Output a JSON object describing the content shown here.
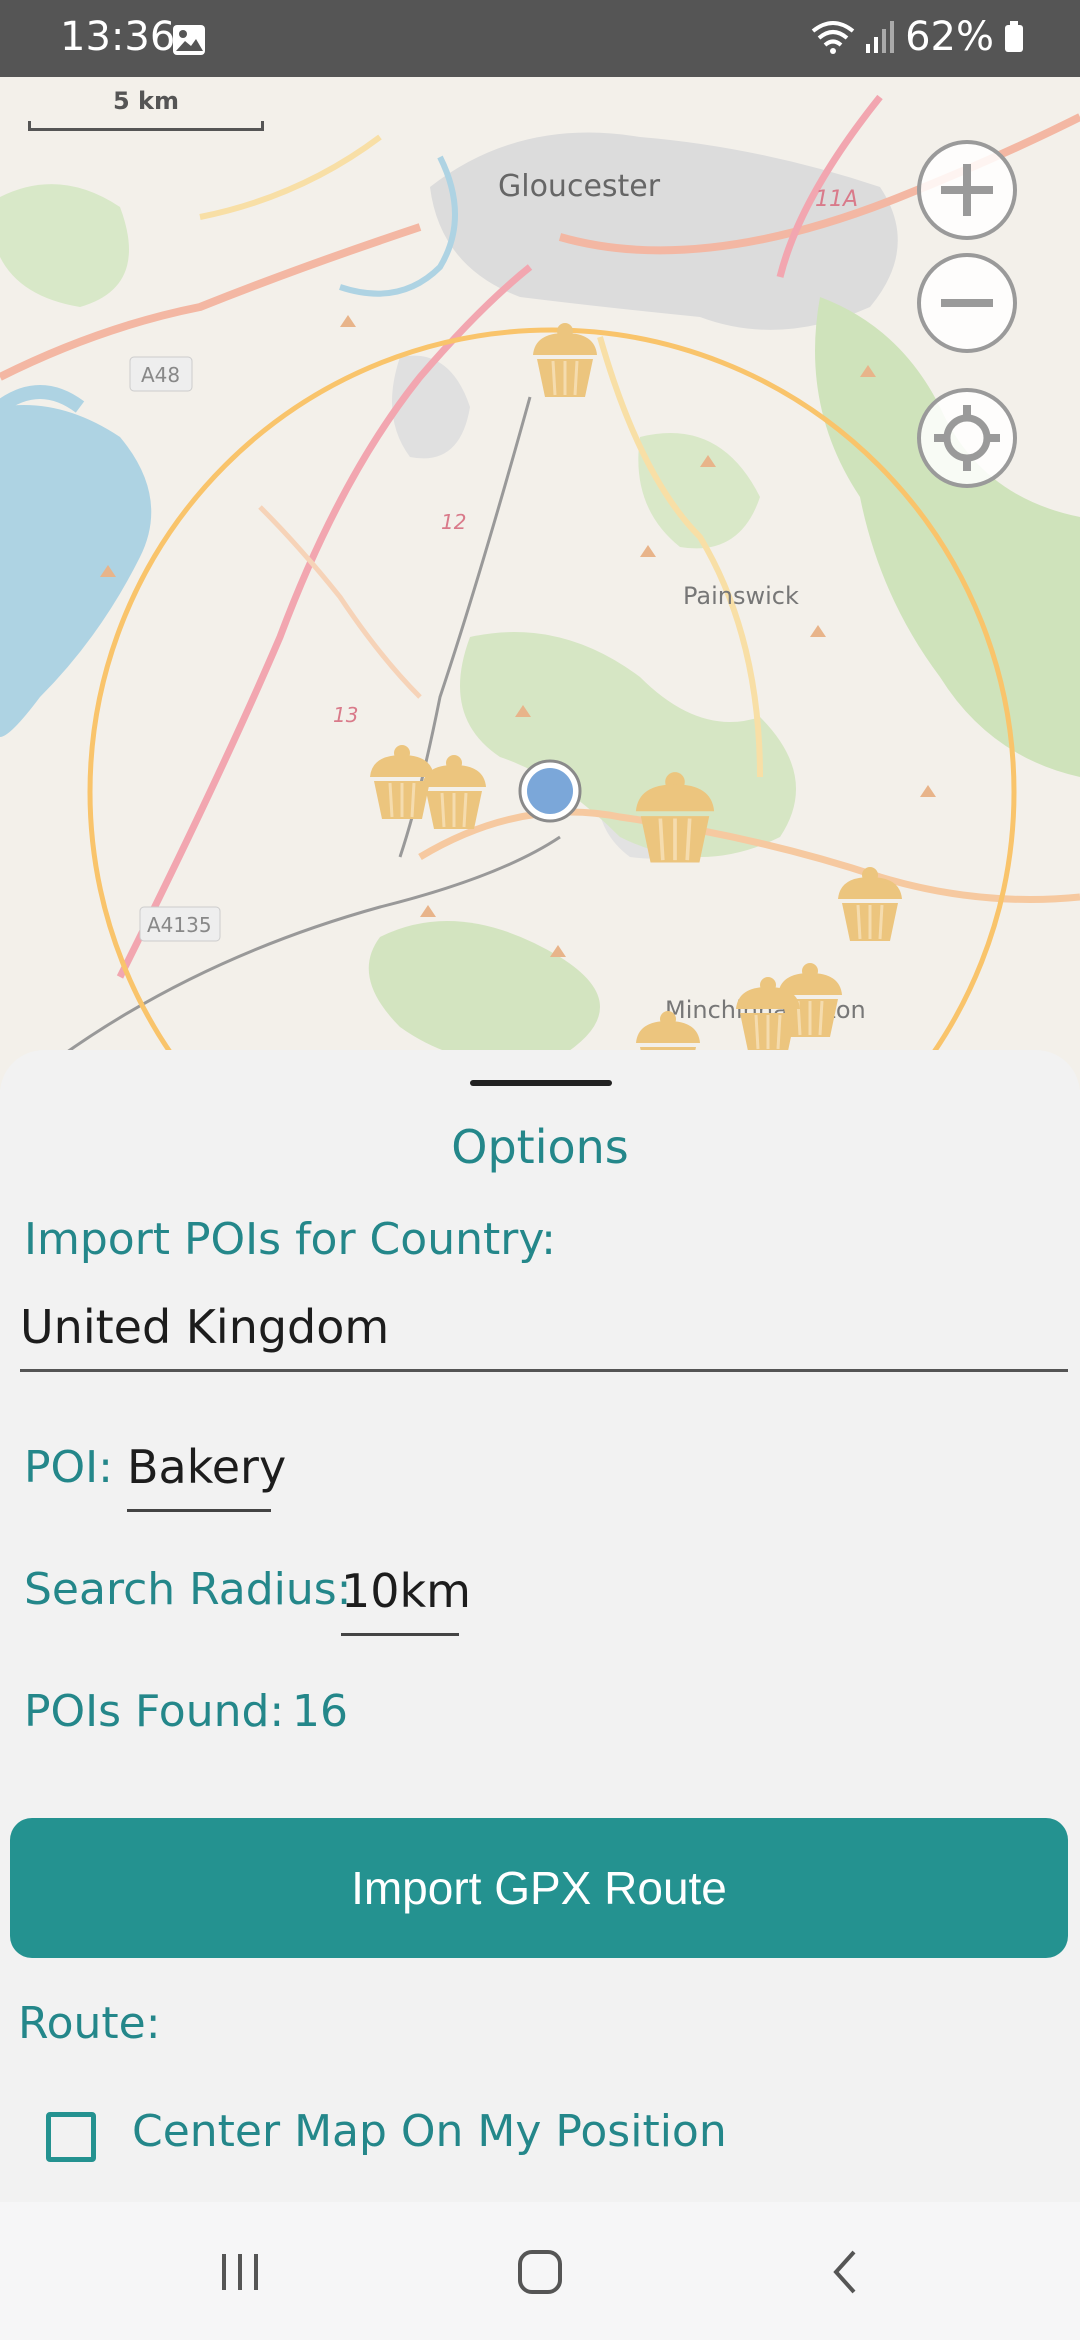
{
  "status_bar": {
    "time": "13:36",
    "battery": "62%",
    "icons": [
      "image-icon",
      "wifi-icon",
      "signal-icon",
      "battery-icon"
    ]
  },
  "map": {
    "scale_label": "5 km",
    "place_labels": [
      "Gloucester",
      "Painswick",
      "Minchinhampton"
    ],
    "road_labels": [
      "A48",
      "A4135",
      "11A",
      "12",
      "13"
    ],
    "controls": [
      "zoom-in-icon",
      "zoom-out-icon",
      "locate-icon"
    ],
    "poi_icon": "cupcake-icon",
    "colors": {
      "search_circle": "#f9c46b",
      "user_dot": "#7ba7d9",
      "poi": "#ecc57e"
    }
  },
  "options": {
    "title": "Options",
    "country_label": "Import POIs for Country:",
    "country_value": "United Kingdom",
    "poi_label": "POI:",
    "poi_value": "Bakery",
    "radius_label": "Search Radius:",
    "radius_value": "10km",
    "found_label": "POIs Found:",
    "found_value": "16",
    "import_button": "Import GPX Route",
    "route_label": "Route:",
    "center_map_label": "Center Map On My Position",
    "center_map_checked": false
  },
  "theme": {
    "accent": "#249290",
    "label": "#24878a"
  },
  "nav_bar": {
    "icons": [
      "recent-apps-icon",
      "home-icon",
      "back-icon"
    ]
  }
}
